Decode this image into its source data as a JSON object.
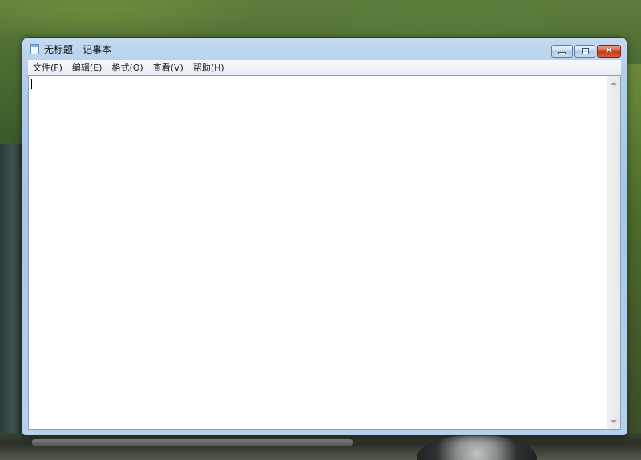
{
  "window": {
    "title": "无标题 - 记事本",
    "app_icon": "notepad-icon"
  },
  "caption_buttons": {
    "minimize": "minimize-icon",
    "maximize": "maximize-icon",
    "close": "close-icon",
    "close_glyph": "✕"
  },
  "menu": {
    "items": [
      {
        "label": "文件(F)"
      },
      {
        "label": "编辑(E)"
      },
      {
        "label": "格式(O)"
      },
      {
        "label": "查看(V)"
      },
      {
        "label": "帮助(H)"
      }
    ]
  },
  "editor": {
    "text": ""
  },
  "colors": {
    "close_button": "#c43d17",
    "titlebar": "#b2cce9",
    "editor_bg": "#ffffff"
  }
}
